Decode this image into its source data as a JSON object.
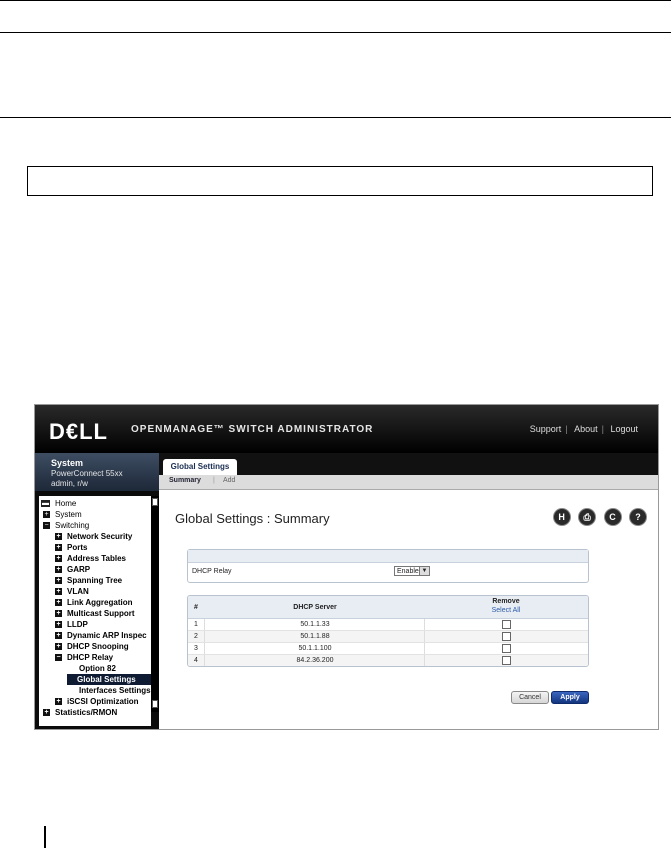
{
  "app": {
    "logo": "D€LL",
    "title": "OPENMANAGE™ SWITCH ADMINISTRATOR",
    "links": [
      "Support",
      "About",
      "Logout"
    ]
  },
  "sidebar": {
    "header": {
      "title": "System",
      "device": "PowerConnect 55xx",
      "user": "admin, r/w"
    },
    "tree": [
      {
        "label": "Home",
        "icon": "folder-icon"
      },
      {
        "label": "System",
        "toggle": "+"
      },
      {
        "label": "Switching",
        "toggle": "−"
      },
      {
        "label": "Network Security",
        "toggle": "+"
      },
      {
        "label": "Ports",
        "toggle": "+"
      },
      {
        "label": "Address Tables",
        "toggle": "+"
      },
      {
        "label": "GARP",
        "toggle": "+"
      },
      {
        "label": "Spanning Tree",
        "toggle": "+"
      },
      {
        "label": "VLAN",
        "toggle": "+"
      },
      {
        "label": "Link Aggregation",
        "toggle": "+"
      },
      {
        "label": "Multicast Support",
        "toggle": "+"
      },
      {
        "label": "LLDP",
        "toggle": "+"
      },
      {
        "label": "Dynamic ARP Inspec",
        "toggle": "+"
      },
      {
        "label": "DHCP Snooping",
        "toggle": "+"
      },
      {
        "label": "DHCP Relay",
        "toggle": "−"
      },
      {
        "label": "Option 82"
      },
      {
        "label": "Global Settings"
      },
      {
        "label": "Interfaces Settings"
      },
      {
        "label": "iSCSI Optimization",
        "toggle": "+"
      },
      {
        "label": "Statistics/RMON",
        "toggle": "+"
      }
    ]
  },
  "main": {
    "tab": "Global Settings",
    "subtabs": [
      "Summary",
      "Add"
    ],
    "page_title": "Global Settings : Summary",
    "tool_icons": [
      "H",
      "print",
      "C",
      "?"
    ],
    "relay": {
      "label": "DHCP Relay",
      "value": "Enable"
    },
    "table": {
      "headers": [
        "#",
        "DHCP Server",
        "Remove",
        "Select All"
      ],
      "rows": [
        {
          "n": "1",
          "ip": "50.1.1.33"
        },
        {
          "n": "2",
          "ip": "50.1.1.88"
        },
        {
          "n": "3",
          "ip": "50.1.1.100"
        },
        {
          "n": "4",
          "ip": "84.2.36.200"
        }
      ]
    },
    "buttons": {
      "cancel": "Cancel",
      "apply": "Apply"
    }
  }
}
